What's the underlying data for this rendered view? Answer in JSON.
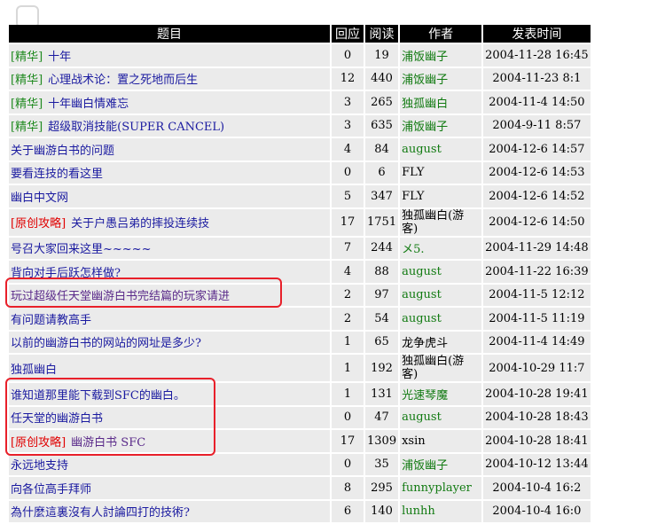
{
  "headers": [
    "题目",
    "回应",
    "阅读",
    "作者",
    "发表时间"
  ],
  "rows": [
    {
      "tag": "[精华]",
      "tag_type": "jh",
      "title": "十年",
      "replies": "0",
      "reads": "19",
      "author": "浦饭幽子",
      "author_plain": false,
      "date": "2004-11-28 16:45"
    },
    {
      "tag": "[精华]",
      "tag_type": "jh",
      "title": "心理战术论：置之死地而后生",
      "replies": "12",
      "reads": "440",
      "author": "浦饭幽子",
      "author_plain": false,
      "date": "2004-11-23 8:1"
    },
    {
      "tag": "[精华]",
      "tag_type": "jh",
      "title": "十年幽白情难忘",
      "replies": "3",
      "reads": "265",
      "author": "独孤幽白",
      "author_plain": false,
      "date": "2004-11-4 14:50"
    },
    {
      "tag": "[精华]",
      "tag_type": "jh",
      "title": "超级取消技能(SUPER  CANCEL)",
      "replies": "3",
      "reads": "635",
      "author": "浦饭幽子",
      "author_plain": false,
      "date": "2004-9-11 8:57"
    },
    {
      "tag": "",
      "tag_type": "",
      "title": "关于幽游白书的问题",
      "replies": "4",
      "reads": "84",
      "author": "august",
      "author_plain": false,
      "date": "2004-12-6 14:57"
    },
    {
      "tag": "",
      "tag_type": "",
      "title": "要看连技的看这里",
      "replies": "0",
      "reads": "6",
      "author": "FLY",
      "author_plain": true,
      "date": "2004-12-6 14:53"
    },
    {
      "tag": "",
      "tag_type": "",
      "title": "幽白中文网",
      "replies": "5",
      "reads": "347",
      "author": "FLY",
      "author_plain": true,
      "date": "2004-12-6 14:52"
    },
    {
      "tag": "[原创攻略]",
      "tag_type": "yc",
      "title": "关于户愚吕弟的摔投连续技",
      "replies": "17",
      "reads": "1751",
      "author": "独孤幽白(游客)",
      "author_plain": true,
      "date": "2004-12-6 14:50"
    },
    {
      "tag": "",
      "tag_type": "",
      "title": "号召大家回来这里~~~~~",
      "replies": "7",
      "reads": "244",
      "author": "メ5.",
      "author_plain": false,
      "date": "2004-11-29 14:48"
    },
    {
      "tag": "",
      "tag_type": "",
      "title": "背向对手后跃怎样做?",
      "replies": "4",
      "reads": "88",
      "author": "august",
      "author_plain": false,
      "date": "2004-11-22 16:39"
    },
    {
      "tag": "",
      "tag_type": "",
      "title": "玩过超级任天堂幽游白书完结篇的玩家请进",
      "replies": "2",
      "reads": "97",
      "author": "august",
      "author_plain": false,
      "date": "2004-11-5 12:12",
      "visited": true
    },
    {
      "tag": "",
      "tag_type": "",
      "title": "有问题请教高手",
      "replies": "2",
      "reads": "54",
      "author": "august",
      "author_plain": false,
      "date": "2004-11-5 11:19"
    },
    {
      "tag": "",
      "tag_type": "",
      "title": "以前的幽游白书的网站的网址是多少?",
      "replies": "1",
      "reads": "65",
      "author": "龙争虎斗",
      "author_plain": true,
      "date": "2004-11-4 14:49"
    },
    {
      "tag": "",
      "tag_type": "",
      "title": "独孤幽白",
      "replies": "1",
      "reads": "192",
      "author": "独孤幽白(游客)",
      "author_plain": true,
      "date": "2004-10-29 11:7"
    },
    {
      "tag": "",
      "tag_type": "",
      "title": "谁知道那里能下载到SFC的幽白。",
      "replies": "1",
      "reads": "131",
      "author": "光速琴魔",
      "author_plain": false,
      "date": "2004-10-28 19:41"
    },
    {
      "tag": "",
      "tag_type": "",
      "title": "任天堂的幽游白书",
      "replies": "0",
      "reads": "47",
      "author": "august",
      "author_plain": false,
      "date": "2004-10-28 18:43"
    },
    {
      "tag": "[原创攻略]",
      "tag_type": "yc",
      "title": "幽游白书 SFC",
      "replies": "17",
      "reads": "1309",
      "author": "xsin",
      "author_plain": true,
      "date": "2004-10-28 18:41",
      "visited": true
    },
    {
      "tag": "",
      "tag_type": "",
      "title": "永远地支持",
      "replies": "0",
      "reads": "35",
      "author": "浦饭幽子",
      "author_plain": false,
      "date": "2004-10-12 13:44"
    },
    {
      "tag": "",
      "tag_type": "",
      "title": "向各位高手拜师",
      "replies": "8",
      "reads": "295",
      "author": "funnyplayer",
      "author_plain": false,
      "date": "2004-10-4 16:2"
    },
    {
      "tag": "",
      "tag_type": "",
      "title": "為什麼這裏沒有人討論四打的技術?",
      "replies": "6",
      "reads": "140",
      "author": "lunhh",
      "author_plain": false,
      "date": "2004-10-4 16:0"
    }
  ],
  "colors": {
    "highlight": "#e8202a",
    "header_bg": "#000000",
    "row_bg": "#ebebeb"
  }
}
